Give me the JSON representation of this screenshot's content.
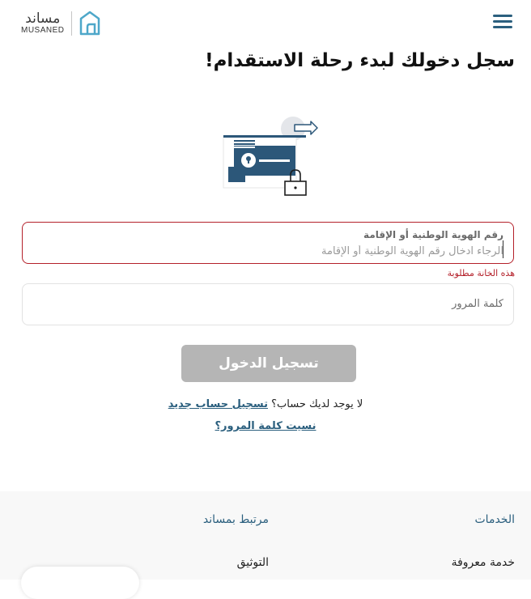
{
  "header": {
    "logo_ar": "مساند",
    "logo_en": "MUSANED"
  },
  "main": {
    "title": "سجل دخولك لبدء رحلة الاستقدام!",
    "id_field": {
      "label": "رقم الهوية الوطنية أو الإقامة",
      "placeholder": "الرجاء ادخال رقم الهوية الوطنية أو الإقامة",
      "error": "هذه الخانة مطلوبة"
    },
    "password_field": {
      "placeholder": "كلمة المرور"
    },
    "login_button": "تسجيل الدخول",
    "no_account_text": "لا يوجد لديك حساب؟",
    "register_link": "تسجيل حساب جديد",
    "forgot_link": "نسيت كلمة المرور؟"
  },
  "footer": {
    "services_title": "الخدمات",
    "services_items": [
      "خدمة معروفة"
    ],
    "related_title": "مرتبط بمساند",
    "related_items": [
      "التوثيق"
    ]
  },
  "colors": {
    "brand": "#2b5f7e",
    "error": "#b4202a",
    "button_disabled": "#b5b5b5",
    "footer_bg": "#f8f8f8"
  }
}
